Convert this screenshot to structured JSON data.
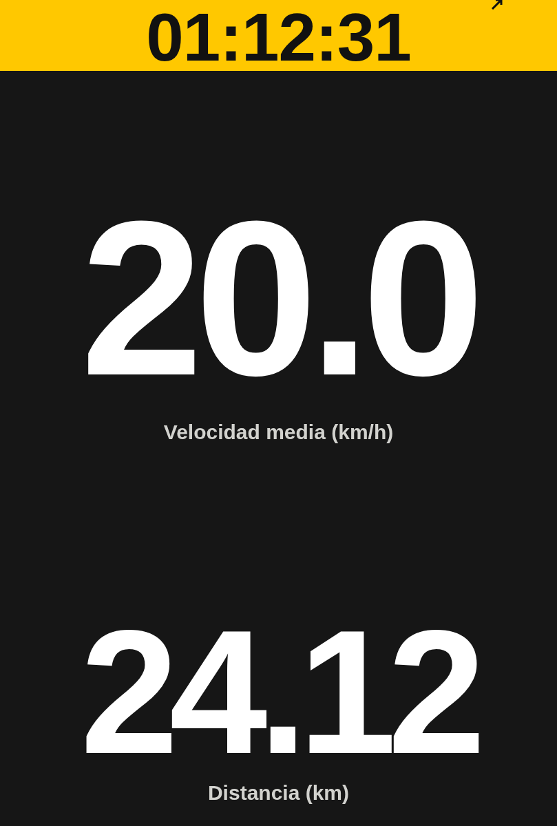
{
  "timer": {
    "elapsed": "01:12:31"
  },
  "metrics": [
    {
      "value": "20.0",
      "label": "Velocidad media (km/h)"
    },
    {
      "value": "24.12",
      "label": "Distancia (km)"
    }
  ]
}
